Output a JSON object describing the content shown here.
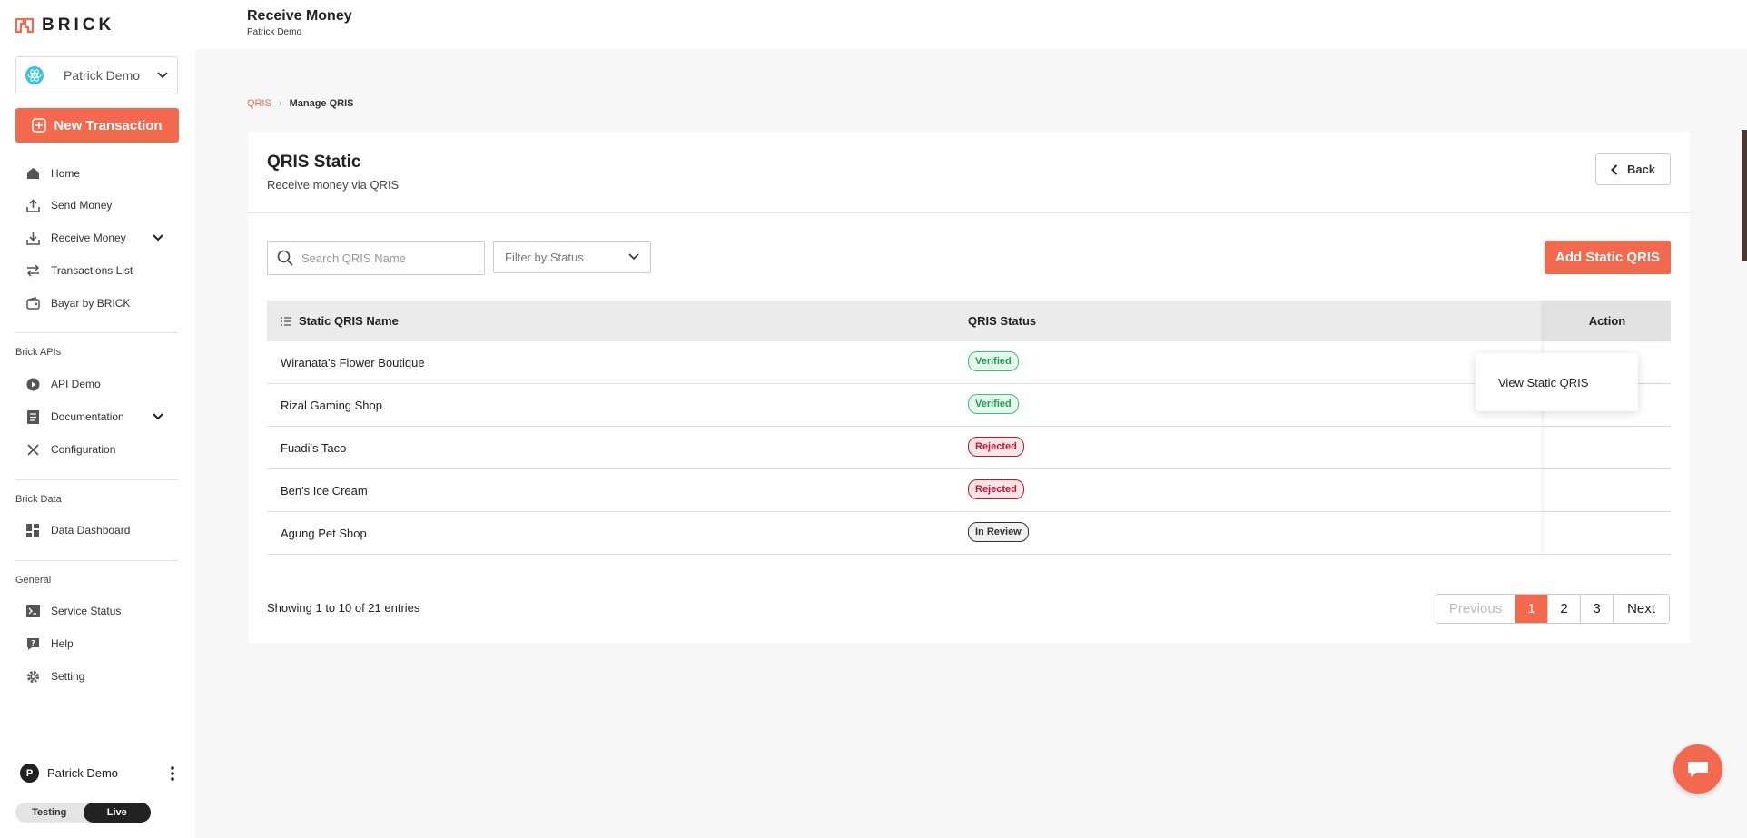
{
  "brand": {
    "logo_text": "BRICK",
    "accent": "#f2694d"
  },
  "workspace": {
    "name": "Patrick Demo"
  },
  "sidebar": {
    "new_transaction": "New Transaction",
    "main_items": [
      {
        "label": "Home",
        "icon": "home-icon"
      },
      {
        "label": "Send Money",
        "icon": "upload-icon"
      },
      {
        "label": "Receive Money",
        "icon": "download-icon"
      },
      {
        "label": "Transactions List",
        "icon": "transfer-icon"
      },
      {
        "label": "Bayar by BRICK",
        "icon": "wallet-icon"
      }
    ],
    "apis_label": "Brick APIs",
    "apis_items": [
      {
        "label": "API Demo",
        "icon": "play-icon"
      },
      {
        "label": "Documentation",
        "icon": "document-icon"
      },
      {
        "label": "Configuration",
        "icon": "tools-icon"
      }
    ],
    "data_label": "Brick Data",
    "data_items": [
      {
        "label": "Data Dashboard",
        "icon": "dashboard-icon"
      }
    ],
    "general_label": "General",
    "general_items": [
      {
        "label": "Service Status",
        "icon": "terminal-icon"
      },
      {
        "label": "Help",
        "icon": "help-icon"
      },
      {
        "label": "Setting",
        "icon": "gear-icon"
      }
    ],
    "user": {
      "initial": "P",
      "name": "Patrick Demo"
    },
    "env": {
      "testing": "Testing",
      "live": "Live",
      "selected": "Live"
    }
  },
  "header": {
    "title": "Receive Money",
    "subtitle": "Patrick Demo"
  },
  "breadcrumb": {
    "parent": "QRIS",
    "separator": "›",
    "current": "Manage QRIS"
  },
  "card": {
    "title": "QRIS Static",
    "subtitle": "Receive money via QRIS",
    "back_label": "Back",
    "search_placeholder": "Search QRIS Name",
    "filter_placeholder": "Filter by Status",
    "add_label": "Add Static QRIS"
  },
  "table": {
    "headers": {
      "name": "Static QRIS Name",
      "status": "QRIS Status",
      "action": "Action"
    },
    "rows": [
      {
        "name": "Wiranata's Flower Boutique",
        "status": "Verified",
        "status_type": "verified"
      },
      {
        "name": "Rizal Gaming Shop",
        "status": "Verified",
        "status_type": "verified"
      },
      {
        "name": "Fuadi's Taco",
        "status": "Rejected",
        "status_type": "rejected"
      },
      {
        "name": "Ben's Ice Cream",
        "status": "Rejected",
        "status_type": "rejected"
      },
      {
        "name": "Agung Pet Shop",
        "status": "In Review",
        "status_type": "review"
      }
    ],
    "action_menu": {
      "view": "View Static QRIS"
    }
  },
  "pagination": {
    "summary": "Showing 1 to 10 of 21 entries",
    "previous": "Previous",
    "pages": [
      "1",
      "2",
      "3"
    ],
    "current_page": "1",
    "next": "Next"
  }
}
